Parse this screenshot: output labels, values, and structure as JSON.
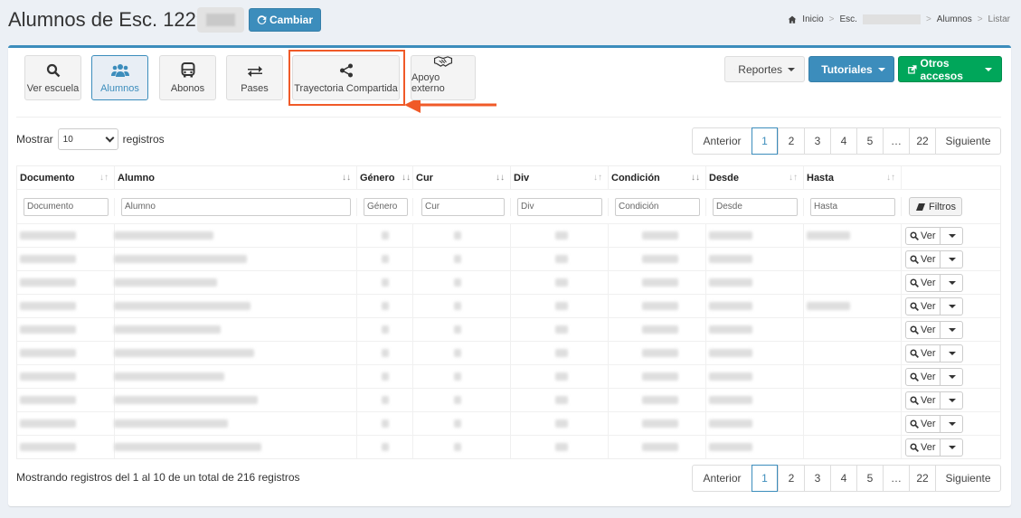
{
  "header": {
    "title": "Alumnos de Esc. 1229 -",
    "cambiar_label": "Cambiar",
    "breadcrumb": {
      "inicio": "Inicio",
      "esc": "Esc.",
      "alumnos": "Alumnos",
      "listar": "Listar"
    }
  },
  "toolbar": {
    "ver_escuela": "Ver escuela",
    "alumnos": "Alumnos",
    "abonos": "Abonos",
    "pases": "Pases",
    "trayectoria": "Trayectoria Compartida",
    "apoyo": "Apoyo externo",
    "reportes": "Reportes",
    "tutoriales": "Tutoriales",
    "otros": "Otros accesos"
  },
  "length_menu": {
    "prefix": "Mostrar",
    "value": "10",
    "suffix": "registros"
  },
  "pagination": {
    "prev": "Anterior",
    "pages": [
      "1",
      "2",
      "3",
      "4",
      "5",
      "…",
      "22"
    ],
    "next": "Siguiente",
    "active": "1"
  },
  "table": {
    "columns": [
      "Documento",
      "Alumno",
      "Género",
      "Cur",
      "Div",
      "Condición",
      "Desde",
      "Hasta"
    ],
    "filters": [
      "Documento",
      "Alumno",
      "Género",
      "Cur",
      "Div",
      "Condición",
      "Desde",
      "Hasta"
    ],
    "filtros_label": "Filtros",
    "ver_label": "Ver"
  },
  "info": "Mostrando registros del 1 al 10 de un total de 216 registros",
  "colors": {
    "primary": "#3c8dbc",
    "success": "#00a65a",
    "highlight": "#f05a28"
  }
}
